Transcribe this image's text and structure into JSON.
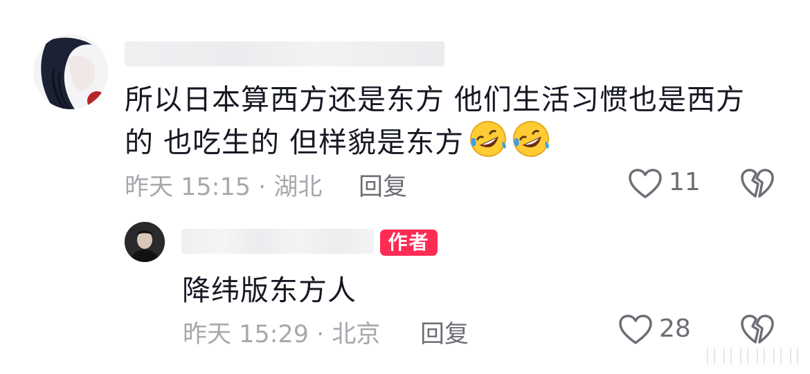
{
  "comments": [
    {
      "username": "",
      "text_line1": "所以日本算西方还是东方 他们生活习惯也是西方",
      "text_line2": "的 也吃生的 但样貌是东方",
      "emoji": [
        "rolling-on-floor-laughing",
        "rolling-on-floor-laughing"
      ],
      "time_location": "昨天 15:15 · 湖北",
      "reply_label": "回复",
      "like_count": "11",
      "icons": [
        "heart-outline-icon",
        "broken-heart-icon"
      ]
    }
  ],
  "reply": {
    "username": "",
    "badge": "作者",
    "text": "降纬版东方人",
    "time_location": "昨天 15:29 · 北京",
    "reply_label": "回复",
    "like_count": "28"
  },
  "colors": {
    "badge": "#fe2c55",
    "meta": "#a7a8ad",
    "action": "#6c6d75",
    "text": "#161823"
  }
}
